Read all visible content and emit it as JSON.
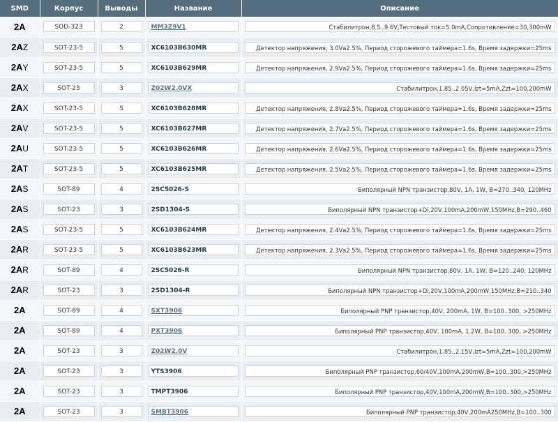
{
  "headers": {
    "smd": "SMD",
    "package": "Корпус",
    "pins": "Выводы",
    "name": "Название",
    "desc": "Описание"
  },
  "rows": [
    {
      "smd": "2A",
      "suffix": "",
      "package": "SOD-323",
      "pins": "2",
      "name": "MM3Z9V1",
      "link": true,
      "desc": "Стабилитрон,8.5..9.6V,Тестовый ток=5.0mA,Сопротивление=30,300mW"
    },
    {
      "smd": "2A",
      "suffix": "Z",
      "package": "SOT-23-5",
      "pins": "5",
      "name": "XC6103B630MR",
      "link": false,
      "desc": "Детектор напряжения, 3.0Vа2.5%, Период сторожевого таймера=1.6s, Время задержки=25ms"
    },
    {
      "smd": "2A",
      "suffix": "Y",
      "package": "SOT-23-5",
      "pins": "5",
      "name": "XC6103B629MR",
      "link": false,
      "desc": "Детектор напряжения, 2.9Vа2.5%, Период сторожевого таймера=1.6s, Время задержки=25ms"
    },
    {
      "smd": "2A",
      "suffix": "X",
      "package": "SOT-23",
      "pins": "3",
      "name": "Z02W2.0VX",
      "link": true,
      "desc": "Стабилитрон,1.85..2.05V,Izt=5mA,Zzt=100,200mW"
    },
    {
      "smd": "2A",
      "suffix": "X",
      "package": "SOT-23-5",
      "pins": "5",
      "name": "XC6103B628MR",
      "link": false,
      "desc": "Детектор напряжения, 2.8Vа2.5%, Период сторожевого таймера=1.6s, Время задержки=25ms"
    },
    {
      "smd": "2A",
      "suffix": "V",
      "package": "SOT-23-5",
      "pins": "5",
      "name": "XC6103B627MR",
      "link": false,
      "desc": "Детектор напряжения, 2.7Vа2.5%, Период сторожевого таймера=1.6s, Время задержки=25ms"
    },
    {
      "smd": "2A",
      "suffix": "U",
      "package": "SOT-23-5",
      "pins": "5",
      "name": "XC6103B626MR",
      "link": false,
      "desc": "Детектор напряжения, 2.6Vа2.5%, Период сторожевого таймера=1.6s, Время задержки=25ms"
    },
    {
      "smd": "2A",
      "suffix": "T",
      "package": "SOT-23-5",
      "pins": "5",
      "name": "XC6103B625MR",
      "link": false,
      "desc": "Детектор напряжения, 2.5Vа2.5%, Период сторожевого таймера=1.6s, Время задержки=25ms"
    },
    {
      "smd": "2A",
      "suffix": "S",
      "package": "SOT-89",
      "pins": "4",
      "name": "2SC5026-S",
      "link": false,
      "desc": "Биполярный NPN транзистор,80V, 1A, 1W, B=270..340, 120MHz"
    },
    {
      "smd": "2A",
      "suffix": "S",
      "package": "SOT-23",
      "pins": "3",
      "name": "2SD1304-S",
      "link": false,
      "desc": "Биполярный NPN транзистор+Di,20V,100mA,200mW,150MHz,B=290..460"
    },
    {
      "smd": "2A",
      "suffix": "S",
      "package": "SOT-23-5",
      "pins": "5",
      "name": "XC6103B624MR",
      "link": false,
      "desc": "Детектор напряжения, 2.4Vа2.5%, Период сторожевого таймера=1.6s, Время задержки=25ms"
    },
    {
      "smd": "2A",
      "suffix": "R",
      "package": "SOT-23-5",
      "pins": "5",
      "name": "XC6103B623MR",
      "link": false,
      "desc": "Детектор напряжения, 2.3Vа2.5%, Период сторожевого таймера=1.6s, Время задержки=25ms"
    },
    {
      "smd": "2A",
      "suffix": "R",
      "package": "SOT-89",
      "pins": "4",
      "name": "2SC5026-R",
      "link": false,
      "desc": "Биполярный NPN транзистор,80V, 1A, 1W, B=120..240, 120MHz"
    },
    {
      "smd": "2A",
      "suffix": "R",
      "package": "SOT-23",
      "pins": "3",
      "name": "2SD1304-R",
      "link": false,
      "desc": "Биполярный NPN транзистор+Di,20V,100mA,200mW,150MHz,B=210..340"
    },
    {
      "smd": "2A",
      "suffix": "",
      "package": "SOT-89",
      "pins": "4",
      "name": "SXT3906",
      "link": true,
      "desc": "Биполярный PNP транзистор,40V, 200mA, 1W, B=100..300, >250MHz"
    },
    {
      "smd": "2A",
      "suffix": "",
      "package": "SOT-89",
      "pins": "4",
      "name": "PXT3906",
      "link": true,
      "desc": "Биполярный PNP транзистор,40V, 100mA, 1.2W, B=100..300, >250MHz"
    },
    {
      "smd": "2A",
      "suffix": "",
      "package": "SOT-23",
      "pins": "3",
      "name": "Z02W2.0V",
      "link": true,
      "desc": "Стабилитрон,1.85..2.15V,Izt=5mA,Zzt=100,200mW"
    },
    {
      "smd": "2A",
      "suffix": "",
      "package": "SOT-23",
      "pins": "3",
      "name": "YTS3906",
      "link": false,
      "desc": "Биполярный PNP транзистор,60/40V,100mA,200mW,B=100..300,>250MHz"
    },
    {
      "smd": "2A",
      "suffix": "",
      "package": "SOT-23",
      "pins": "3",
      "name": "TMPT3906",
      "link": false,
      "desc": "Биполярный PNP транзистор,40V,100mA,200mW,B=100..300,>250MHz"
    },
    {
      "smd": "2A",
      "suffix": "",
      "package": "SOT-23",
      "pins": "3",
      "name": "SMBT3906",
      "link": true,
      "desc": "Биполярный PNP транзистор,40V,200mA250MHz,B=100..300"
    }
  ]
}
